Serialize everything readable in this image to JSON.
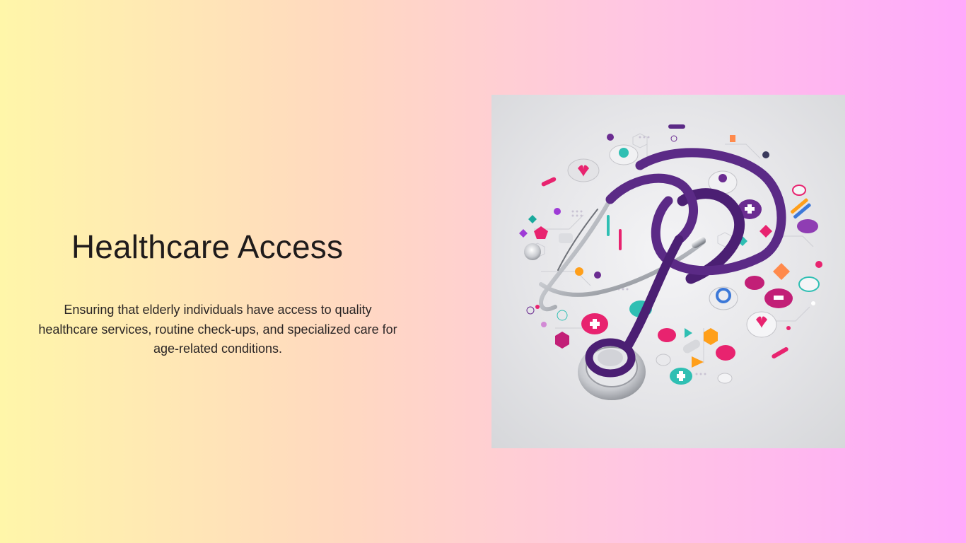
{
  "slide": {
    "title": "Healthcare Access",
    "body": "Ensuring that elderly individuals have access to quality healthcare services, routine check-ups, and specialized care for age-related conditions."
  },
  "image": {
    "subject": "stethoscope surrounded by colorful medical icons",
    "icon": "stethoscope-icon"
  },
  "colors": {
    "background_left": "#fff6a9",
    "background_right": "#ffa9fb",
    "accent_purple": "#5b2a86",
    "accent_magenta": "#e8236f",
    "accent_teal": "#22b3a3",
    "text": "#1f1b1b"
  }
}
